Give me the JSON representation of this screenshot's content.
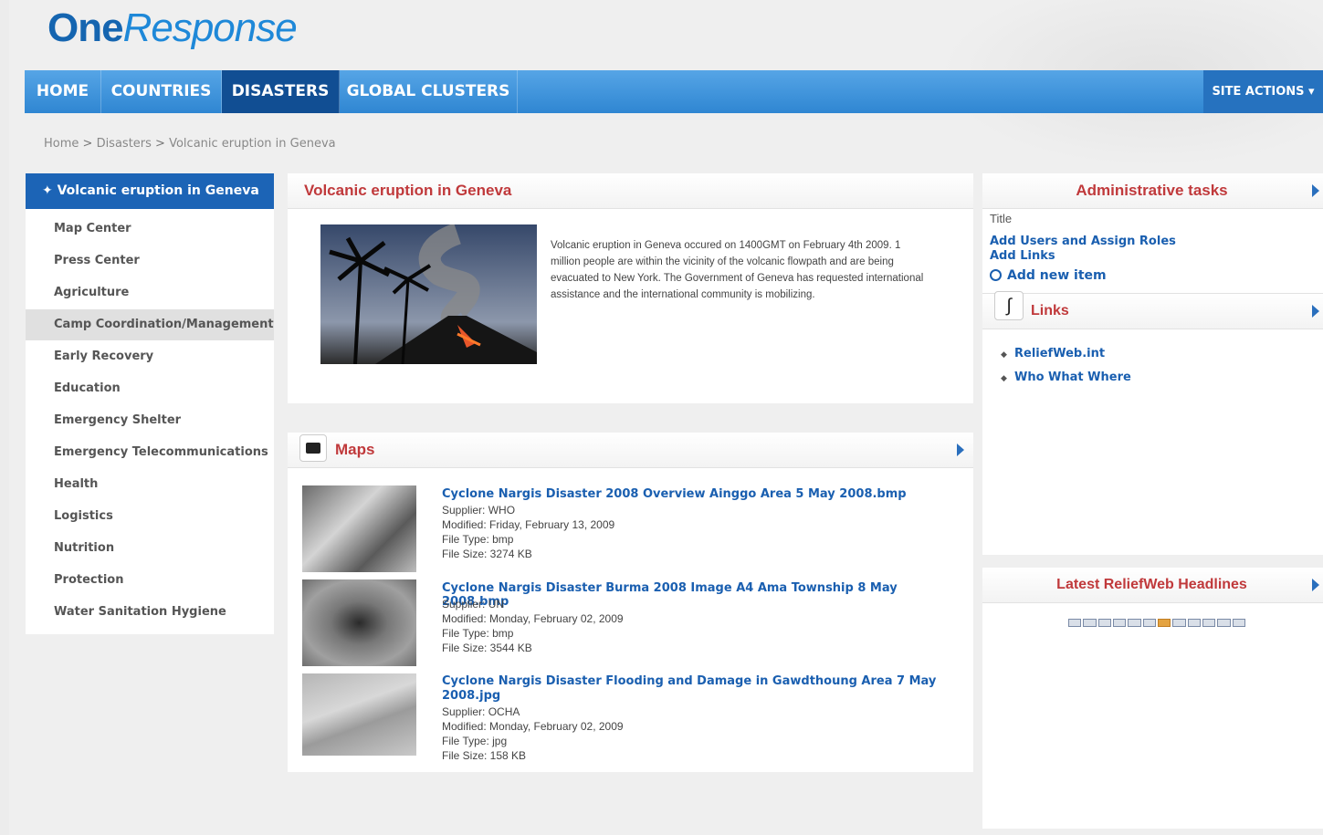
{
  "logo": {
    "one": "One",
    "response": "Response"
  },
  "nav": {
    "items": [
      "HOME",
      "COUNTRIES",
      "DISASTERS",
      "GLOBAL CLUSTERS"
    ],
    "active": "DISASTERS",
    "site_actions": "SITE ACTIONS ▾"
  },
  "breadcrumb": {
    "home": "Home",
    "disasters": "Disasters",
    "current": "Volcanic eruption in Geneva"
  },
  "left_nav": {
    "header": "✦ Volcanic eruption in Geneva",
    "items": [
      "Map Center",
      "Press Center",
      "Agriculture",
      "Camp Coordination/Management",
      "Early Recovery",
      "Education",
      "Emergency Shelter",
      "Emergency Telecommunications",
      "Health",
      "Logistics",
      "Nutrition",
      "Protection",
      "Water Sanitation Hygiene"
    ],
    "selected": "Camp Coordination/Management"
  },
  "event": {
    "title": "Volcanic eruption in Geneva",
    "description": "Volcanic eruption in Geneva occured on 1400GMT on February 4th 2009. 1 million people are within the vicinity of the volcanic flowpath and are being evacuated to New York. The Government of Geneva has requested international assistance and the international community is mobilizing."
  },
  "maps": {
    "title": "Maps",
    "items": [
      {
        "name": "Cyclone Nargis Disaster 2008 Overview Ainggo Area 5 May 2008.bmp",
        "supplier": "Supplier: WHO",
        "modified": "Modified: Friday, February 13, 2009",
        "type": "File Type: bmp",
        "size": "File Size: 3274 KB"
      },
      {
        "name": "Cyclone Nargis Disaster Burma 2008 Image A4 Ama Township 8 May 2008.bmp",
        "supplier": "Supplier: UN",
        "modified": "Modified: Monday, February 02, 2009",
        "type": "File Type: bmp",
        "size": "File Size: 3544 KB"
      },
      {
        "name": "Cyclone Nargis Disaster Flooding and Damage in Gawdthoung Area 7 May 2008.jpg",
        "supplier": "Supplier: OCHA",
        "modified": "Modified: Monday, February 02, 2009",
        "type": "File Type: jpg",
        "size": "File Size: 158 KB"
      }
    ]
  },
  "admin": {
    "title": "Administrative tasks",
    "label": "Title",
    "links": [
      "Add Users and Assign Roles",
      "Add Links"
    ],
    "add_new": "Add new item"
  },
  "links_panel": {
    "title": "Links",
    "items": [
      "ReliefWeb.int",
      "Who What Where"
    ]
  },
  "headlines": {
    "title": "Latest ReliefWeb Headlines",
    "pager_count": 12,
    "pager_active": 6
  },
  "colors": {
    "brand_blue": "#1c64b6",
    "nav_blue": "#2f86d2",
    "title_red": "#c0393b",
    "link_blue": "#1a5fb0"
  }
}
